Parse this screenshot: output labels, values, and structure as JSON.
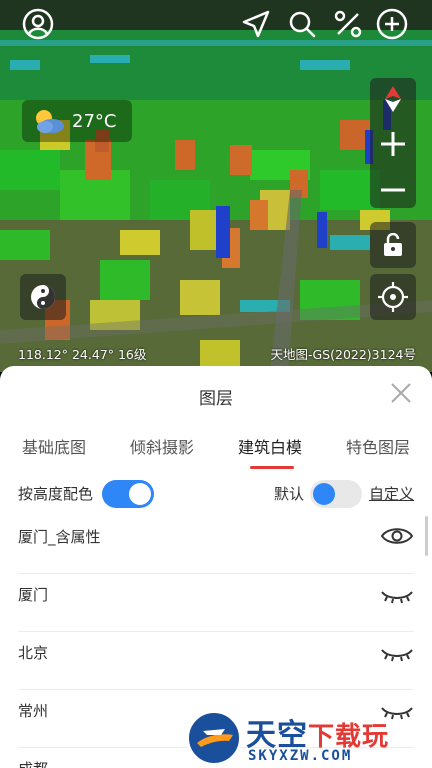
{
  "map": {
    "weather": {
      "icon": "weather-partly-cloudy-icon",
      "temperature": "27°C"
    },
    "coordinates": "118.12°  24.47°  16级",
    "copyright": "天地图-GS(2022)3124号",
    "top_icons": [
      "user-icon",
      "navigation-icon",
      "search-icon",
      "measure-icon",
      "add-icon"
    ],
    "controls": [
      "compass-icon",
      "zoom-in-icon",
      "zoom-out-icon",
      "lock-icon",
      "locate-icon",
      "taiji-icon"
    ]
  },
  "sheet": {
    "title": "图层",
    "tabs": [
      {
        "label": "基础底图"
      },
      {
        "label": "倾斜摄影"
      },
      {
        "label": "建筑白模",
        "active": true
      },
      {
        "label": "特色图层"
      }
    ],
    "options": {
      "height_color_label": "按高度配色",
      "height_color_on": true,
      "default_label": "默认",
      "default_on": false,
      "custom_label": "自定义"
    },
    "layers": [
      {
        "name": "厦门_含属性",
        "visible": true
      },
      {
        "name": "厦门",
        "visible": false
      },
      {
        "name": "北京",
        "visible": false
      },
      {
        "name": "常州",
        "visible": false
      },
      {
        "name": "成都",
        "visible": false
      }
    ]
  },
  "watermark": {
    "text_blue": "天空",
    "text_red": "下载玩",
    "sub": "SKYXZW.COM"
  },
  "colors": {
    "accent": "#2f86f6",
    "active_tab_indicator": "#e53935",
    "text": "#333333"
  }
}
